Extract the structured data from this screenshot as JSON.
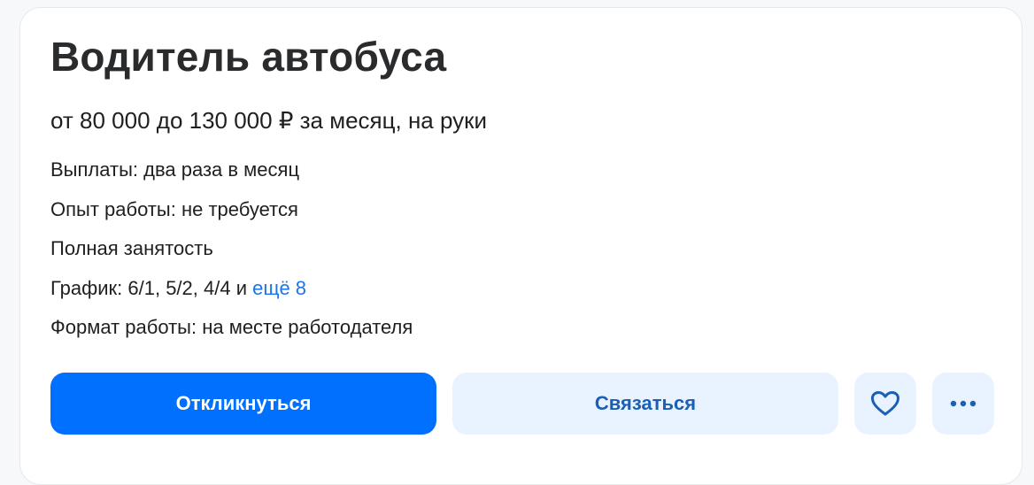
{
  "vacancy": {
    "title": "Водитель автобуса",
    "salary": "от 80 000 до 130 000 ₽ за месяц, на руки",
    "payments": "Выплаты: два раза в месяц",
    "experience": "Опыт работы: не требуется",
    "employment": "Полная занятость",
    "schedule_prefix": "График: 6/1, 5/2, 4/4 и ",
    "schedule_more": "ещё 8",
    "work_format": "Формат работы: на месте работодателя"
  },
  "actions": {
    "apply_label": "Откликнуться",
    "contact_label": "Связаться",
    "favorite_icon": "heart-icon",
    "more_icon": "more-horizontal-icon"
  },
  "colors": {
    "primary": "#0070ff",
    "secondary_bg": "#e8f3ff",
    "secondary_text": "#1a5fb4",
    "link": "#1c74e9"
  }
}
